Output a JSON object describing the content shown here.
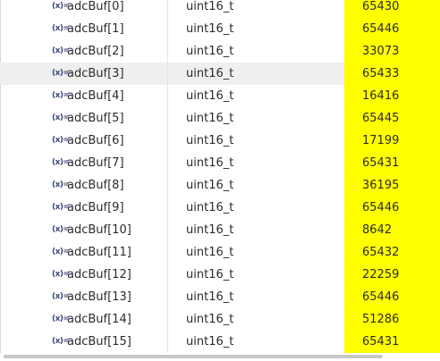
{
  "colors": {
    "value_highlight": "#ffff00",
    "selected_row": "#efefef"
  },
  "icon_name": "variable-icon",
  "icon_glyph": "(x)=",
  "rows": [
    {
      "name": "adcBuf[0]",
      "type": "uint16_t",
      "value": "65430"
    },
    {
      "name": "adcBuf[1]",
      "type": "uint16_t",
      "value": "65446"
    },
    {
      "name": "adcBuf[2]",
      "type": "uint16_t",
      "value": "33073"
    },
    {
      "name": "adcBuf[3]",
      "type": "uint16_t",
      "value": "65433",
      "selected": true
    },
    {
      "name": "adcBuf[4]",
      "type": "uint16_t",
      "value": "16416"
    },
    {
      "name": "adcBuf[5]",
      "type": "uint16_t",
      "value": "65445"
    },
    {
      "name": "adcBuf[6]",
      "type": "uint16_t",
      "value": "17199"
    },
    {
      "name": "adcBuf[7]",
      "type": "uint16_t",
      "value": "65431"
    },
    {
      "name": "adcBuf[8]",
      "type": "uint16_t",
      "value": "36195"
    },
    {
      "name": "adcBuf[9]",
      "type": "uint16_t",
      "value": "65446"
    },
    {
      "name": "adcBuf[10]",
      "type": "uint16_t",
      "value": "8642"
    },
    {
      "name": "adcBuf[11]",
      "type": "uint16_t",
      "value": "65432"
    },
    {
      "name": "adcBuf[12]",
      "type": "uint16_t",
      "value": "22259"
    },
    {
      "name": "adcBuf[13]",
      "type": "uint16_t",
      "value": "65446"
    },
    {
      "name": "adcBuf[14]",
      "type": "uint16_t",
      "value": "51286"
    },
    {
      "name": "adcBuf[15]",
      "type": "uint16_t",
      "value": "65431"
    }
  ]
}
